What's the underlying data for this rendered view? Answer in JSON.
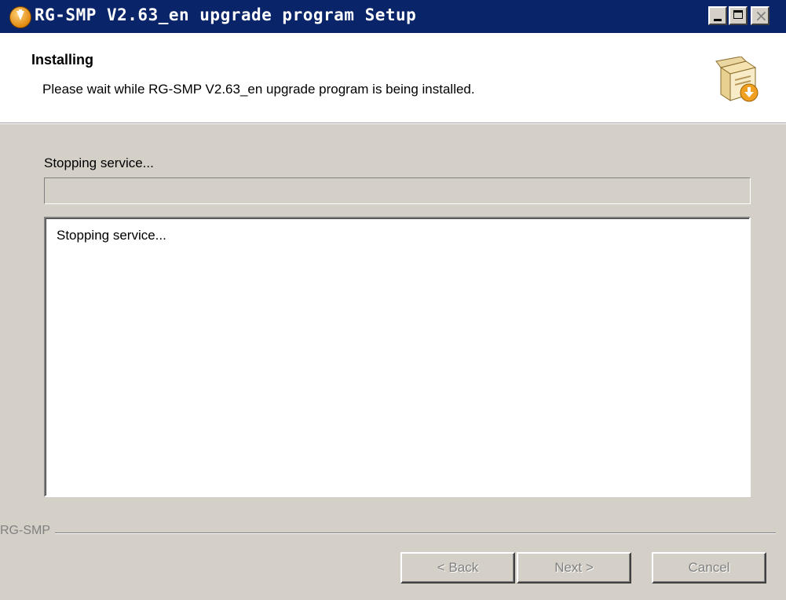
{
  "window": {
    "title": "RG-SMP V2.63_en upgrade program Setup",
    "title_bar_color": "#0a246a",
    "icon": "installer-disc-icon",
    "controls": {
      "minimize": "minimize-icon",
      "maximize": "maximize-icon",
      "close": "close-icon",
      "close_glyph": "×"
    }
  },
  "header": {
    "title": "Installing",
    "subtitle": "Please wait while RG-SMP V2.63_en upgrade program is being installed.",
    "icon": "setup-box-icon"
  },
  "main": {
    "status_label": "Stopping service...",
    "progress_percent": 0,
    "log_lines": [
      "Stopping service..."
    ]
  },
  "branding": {
    "text": "RG-SMP"
  },
  "buttons": {
    "back": "< Back",
    "next": "Next >",
    "cancel": "Cancel"
  }
}
